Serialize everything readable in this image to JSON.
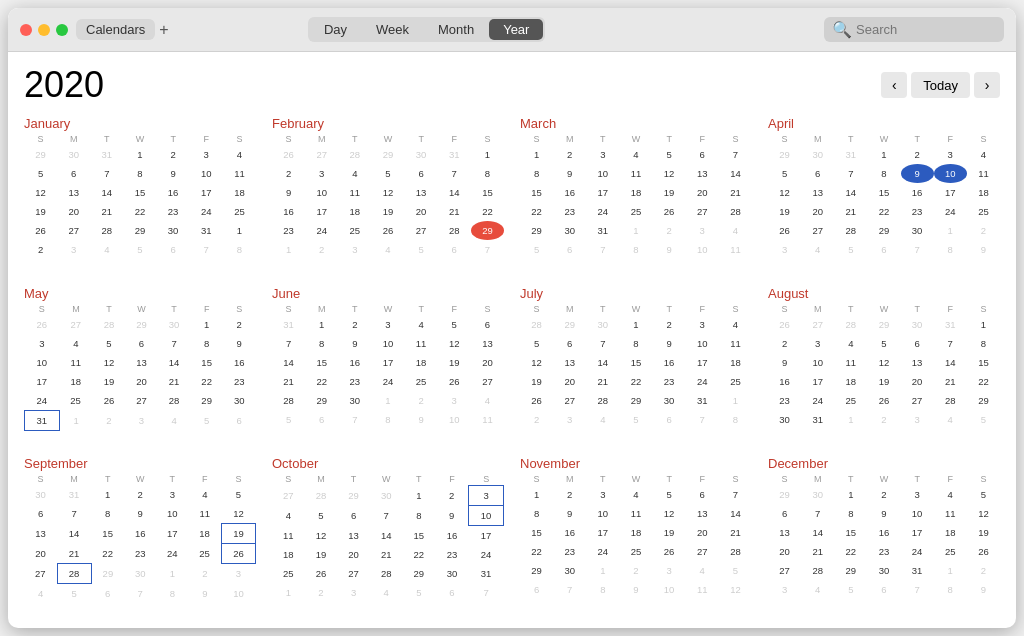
{
  "titlebar": {
    "app_name": "Calendars",
    "plus_label": "+",
    "tabs": [
      "Day",
      "Week",
      "Month",
      "Year"
    ],
    "active_tab": "Year",
    "search_placeholder": "Search"
  },
  "year": "2020",
  "nav": {
    "prev": "‹",
    "today": "Today",
    "next": "›"
  },
  "months": [
    {
      "name": "January",
      "days_header": [
        "S",
        "M",
        "T",
        "W",
        "T",
        "F",
        "S"
      ],
      "weeks": [
        [
          "29",
          "30",
          "31",
          "1",
          "2",
          "3",
          "4"
        ],
        [
          "5",
          "6",
          "7",
          "8",
          "9",
          "10",
          "11"
        ],
        [
          "12",
          "13",
          "14",
          "15",
          "16",
          "17",
          "18"
        ],
        [
          "19",
          "20",
          "21",
          "22",
          "23",
          "24",
          "25"
        ],
        [
          "26",
          "27",
          "28",
          "29",
          "30",
          "31",
          "1"
        ],
        [
          "2",
          "3",
          "4",
          "5",
          "6",
          "7",
          "8"
        ]
      ],
      "other_month_start": [
        "29",
        "30",
        "31"
      ],
      "other_month_end": [
        "1",
        "2",
        "3",
        "4",
        "5",
        "6",
        "7",
        "8"
      ],
      "specials": {}
    },
    {
      "name": "February",
      "days_header": [
        "S",
        "M",
        "T",
        "W",
        "T",
        "F",
        "S"
      ],
      "weeks": [
        [
          "26",
          "27",
          "28",
          "29",
          "30",
          "31",
          "1"
        ],
        [
          "2",
          "3",
          "4",
          "5",
          "6",
          "7",
          "8"
        ],
        [
          "9",
          "10",
          "11",
          "12",
          "13",
          "14",
          "15"
        ],
        [
          "16",
          "17",
          "18",
          "19",
          "20",
          "21",
          "22"
        ],
        [
          "23",
          "24",
          "25",
          "26",
          "27",
          "28",
          "29"
        ],
        [
          "1",
          "2",
          "3",
          "4",
          "5",
          "6",
          "7"
        ]
      ],
      "specials": {}
    },
    {
      "name": "March",
      "days_header": [
        "S",
        "M",
        "T",
        "W",
        "T",
        "F",
        "S"
      ],
      "weeks": [
        [
          "1",
          "2",
          "3",
          "4",
          "5",
          "6",
          "7"
        ],
        [
          "8",
          "9",
          "10",
          "11",
          "12",
          "13",
          "14"
        ],
        [
          "15",
          "16",
          "17",
          "18",
          "19",
          "20",
          "21"
        ],
        [
          "22",
          "23",
          "24",
          "25",
          "26",
          "27",
          "28"
        ],
        [
          "29",
          "30",
          "31",
          "1",
          "2",
          "3",
          "4"
        ],
        [
          "5",
          "6",
          "7",
          "8",
          "9",
          "10",
          "11"
        ]
      ],
      "specials": {}
    },
    {
      "name": "April",
      "days_header": [
        "S",
        "M",
        "T",
        "W",
        "T",
        "F",
        "S"
      ],
      "weeks": [
        [
          "29",
          "30",
          "31",
          "1",
          "2",
          "3",
          "4"
        ],
        [
          "5",
          "6",
          "7",
          "8",
          "9",
          "10",
          "11"
        ],
        [
          "12",
          "13",
          "14",
          "15",
          "16",
          "17",
          "18"
        ],
        [
          "19",
          "20",
          "21",
          "22",
          "23",
          "24",
          "25"
        ],
        [
          "26",
          "27",
          "28",
          "29",
          "30",
          "1",
          "2"
        ],
        [
          "3",
          "4",
          "5",
          "6",
          "7",
          "8",
          "9"
        ]
      ],
      "specials": {}
    },
    {
      "name": "May",
      "days_header": [
        "S",
        "M",
        "T",
        "W",
        "T",
        "F",
        "S"
      ],
      "weeks": [
        [
          "26",
          "27",
          "28",
          "29",
          "30",
          "1",
          "2"
        ],
        [
          "3",
          "4",
          "5",
          "6",
          "7",
          "8",
          "9"
        ],
        [
          "10",
          "11",
          "12",
          "13",
          "14",
          "15",
          "16"
        ],
        [
          "17",
          "18",
          "19",
          "20",
          "21",
          "22",
          "23"
        ],
        [
          "24",
          "25",
          "26",
          "27",
          "28",
          "29",
          "30"
        ],
        [
          "31",
          "1",
          "2",
          "3",
          "4",
          "5",
          "6"
        ]
      ],
      "specials": {}
    },
    {
      "name": "June",
      "days_header": [
        "S",
        "M",
        "T",
        "W",
        "T",
        "F",
        "S"
      ],
      "weeks": [
        [
          "31",
          "1",
          "2",
          "3",
          "4",
          "5",
          "6"
        ],
        [
          "7",
          "8",
          "9",
          "10",
          "11",
          "12",
          "13"
        ],
        [
          "14",
          "15",
          "16",
          "17",
          "18",
          "19",
          "20"
        ],
        [
          "21",
          "22",
          "23",
          "24",
          "25",
          "26",
          "27"
        ],
        [
          "28",
          "29",
          "30",
          "1",
          "2",
          "3",
          "4"
        ],
        [
          "5",
          "6",
          "7",
          "8",
          "9",
          "10",
          "11"
        ]
      ],
      "specials": {}
    },
    {
      "name": "July",
      "days_header": [
        "S",
        "M",
        "T",
        "W",
        "T",
        "F",
        "S"
      ],
      "weeks": [
        [
          "28",
          "29",
          "30",
          "1",
          "2",
          "3",
          "4"
        ],
        [
          "5",
          "6",
          "7",
          "8",
          "9",
          "10",
          "11"
        ],
        [
          "12",
          "13",
          "14",
          "15",
          "16",
          "17",
          "18"
        ],
        [
          "19",
          "20",
          "21",
          "22",
          "23",
          "24",
          "25"
        ],
        [
          "26",
          "27",
          "28",
          "29",
          "30",
          "31",
          "1"
        ],
        [
          "2",
          "3",
          "4",
          "5",
          "6",
          "7",
          "8"
        ]
      ],
      "specials": {}
    },
    {
      "name": "August",
      "days_header": [
        "S",
        "M",
        "T",
        "W",
        "T",
        "F",
        "S"
      ],
      "weeks": [
        [
          "26",
          "27",
          "28",
          "29",
          "30",
          "31",
          "1"
        ],
        [
          "2",
          "3",
          "4",
          "5",
          "6",
          "7",
          "8"
        ],
        [
          "9",
          "10",
          "11",
          "12",
          "13",
          "14",
          "15"
        ],
        [
          "16",
          "17",
          "18",
          "19",
          "20",
          "21",
          "22"
        ],
        [
          "23",
          "24",
          "25",
          "26",
          "27",
          "28",
          "29"
        ],
        [
          "30",
          "31",
          "1",
          "2",
          "3",
          "4",
          "5"
        ]
      ],
      "specials": {}
    },
    {
      "name": "September",
      "days_header": [
        "S",
        "M",
        "T",
        "W",
        "T",
        "F",
        "S"
      ],
      "weeks": [
        [
          "30",
          "31",
          "1",
          "2",
          "3",
          "4",
          "5"
        ],
        [
          "6",
          "7",
          "8",
          "9",
          "10",
          "11",
          "12"
        ],
        [
          "13",
          "14",
          "15",
          "16",
          "17",
          "18",
          "19"
        ],
        [
          "20",
          "21",
          "22",
          "23",
          "24",
          "25",
          "26"
        ],
        [
          "27",
          "28",
          "29",
          "30",
          "1",
          "2",
          "3"
        ],
        [
          "4",
          "5",
          "6",
          "7",
          "8",
          "9",
          "10"
        ]
      ],
      "specials": {}
    },
    {
      "name": "October",
      "days_header": [
        "S",
        "M",
        "T",
        "W",
        "T",
        "F",
        "S"
      ],
      "weeks": [
        [
          "27",
          "28",
          "29",
          "30",
          "1",
          "2",
          "3"
        ],
        [
          "4",
          "5",
          "6",
          "7",
          "8",
          "9",
          "10"
        ],
        [
          "11",
          "12",
          "13",
          "14",
          "15",
          "16",
          "17"
        ],
        [
          "18",
          "19",
          "20",
          "21",
          "22",
          "23",
          "24"
        ],
        [
          "25",
          "26",
          "27",
          "28",
          "29",
          "30",
          "31"
        ],
        [
          "1",
          "2",
          "3",
          "4",
          "5",
          "6",
          "7"
        ]
      ],
      "specials": {}
    },
    {
      "name": "November",
      "days_header": [
        "S",
        "M",
        "T",
        "W",
        "T",
        "F",
        "S"
      ],
      "weeks": [
        [
          "1",
          "2",
          "3",
          "4",
          "5",
          "6",
          "7"
        ],
        [
          "8",
          "9",
          "10",
          "11",
          "12",
          "13",
          "14"
        ],
        [
          "15",
          "16",
          "17",
          "18",
          "19",
          "20",
          "21"
        ],
        [
          "22",
          "23",
          "24",
          "25",
          "26",
          "27",
          "28"
        ],
        [
          "29",
          "30",
          "1",
          "2",
          "3",
          "4",
          "5"
        ],
        [
          "6",
          "7",
          "8",
          "9",
          "10",
          "11",
          "12"
        ]
      ],
      "specials": {}
    },
    {
      "name": "December",
      "days_header": [
        "S",
        "M",
        "T",
        "W",
        "T",
        "F",
        "S"
      ],
      "weeks": [
        [
          "29",
          "30",
          "1",
          "2",
          "3",
          "4",
          "5"
        ],
        [
          "6",
          "7",
          "8",
          "9",
          "10",
          "11",
          "12"
        ],
        [
          "13",
          "14",
          "15",
          "16",
          "17",
          "18",
          "19"
        ],
        [
          "20",
          "21",
          "22",
          "23",
          "24",
          "25",
          "26"
        ],
        [
          "27",
          "28",
          "29",
          "30",
          "31",
          "1",
          "2"
        ],
        [
          "3",
          "4",
          "5",
          "6",
          "7",
          "8",
          "9"
        ]
      ],
      "specials": {}
    }
  ]
}
